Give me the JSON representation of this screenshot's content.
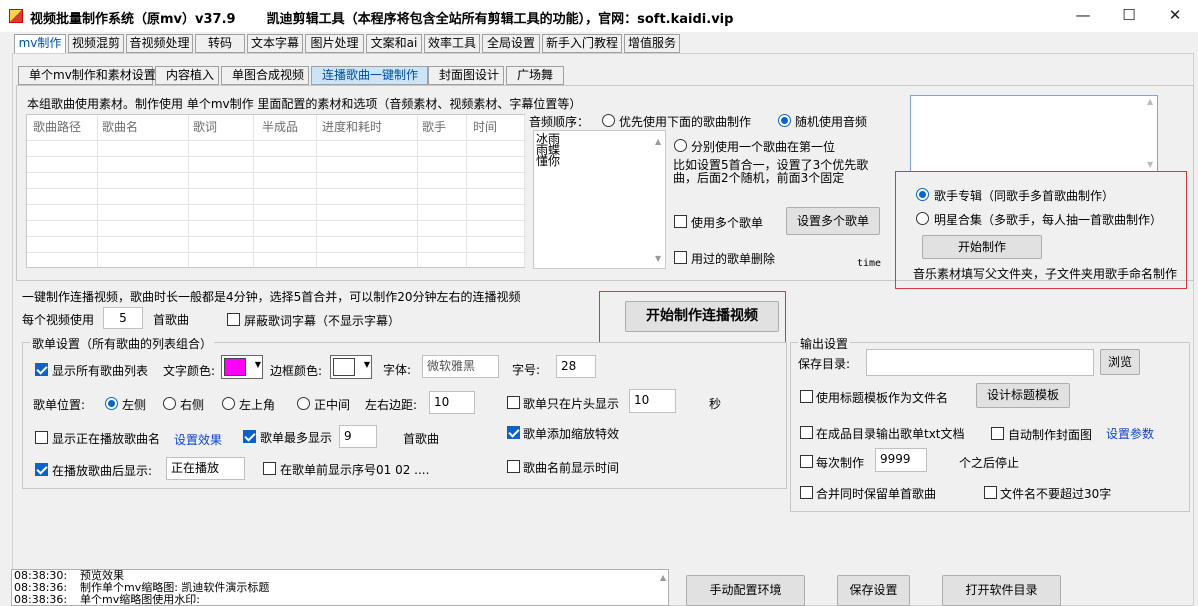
{
  "window": {
    "title": "视频批量制作系统（原mv）v37.9",
    "subtitle": "凯迪剪辑工具（本程序将包含全站所有剪辑工具的功能），官网：soft.kaidi.vip",
    "minimize": "—",
    "maximize": "☐",
    "close": "✕"
  },
  "main_tabs": [
    "mv制作",
    "视频混剪",
    "音视频处理",
    "转码",
    "文本字幕",
    "图片处理",
    "文案和ai",
    "效率工具",
    "全局设置",
    "新手入门教程",
    "增值服务"
  ],
  "sub_tabs": [
    "单个mv制作和素材设置",
    "内容植入",
    "单图合成视频",
    "连播歌曲一键制作",
    "封面图设计",
    "广场舞"
  ],
  "song_group": {
    "label": "本组歌曲使用素材。制作使用 单个mv制作 里面配置的素材和选项（音频素材、视频素材、字幕位置等）",
    "columns": [
      "歌曲路径",
      "歌曲名",
      "歌词",
      "半成品",
      "进度和耗时",
      "歌手",
      "时间"
    ]
  },
  "audio_order": {
    "label": "音频顺序：",
    "songs": [
      "冰雨",
      "雨蝶",
      "懂你"
    ],
    "opt_priority": "优先使用下面的歌曲制作",
    "opt_random": "随机使用音频",
    "opt_each_first": "分别使用一个歌曲在第一位",
    "note": "比如设置5首合一，设置了3个优先歌曲，后面2个随机，前面3个固定",
    "use_multi_list": "使用多个歌单",
    "set_multi_list": "设置多个歌单",
    "delete_used": "用过的歌单删除",
    "time_label": "time"
  },
  "artist_box": {
    "opt_album": "歌手专辑（同歌手多首歌曲制作）",
    "opt_collection": "明星合集（多歌手，每人抽一首歌曲制作）",
    "start": "开始制作",
    "note": "音乐素材填写父文件夹，子文件夹用歌手命名制作"
  },
  "one_click": {
    "label": "一键制作连播视频，歌曲时长一般都是4分钟，选择5首合并，可以制作20分钟左右的连播视频",
    "per_video": "每个视频使用",
    "count": "5",
    "unit": "首歌曲",
    "mask_lyrics": "屏蔽歌词字幕（不显示字幕）",
    "start_big": "开始制作连播视频"
  },
  "playlist": {
    "label": "歌单设置（所有歌曲的列表组合）",
    "show_all": "显示所有歌曲列表",
    "text_color_label": "文字颜色:",
    "text_color": "#ff00ff",
    "border_color_label": "边框颜色:",
    "border_color": "#ffffff",
    "font_label": "字体:",
    "font_value": "微软雅黑",
    "size_label": "字号:",
    "size_value": "28",
    "position_label": "歌单位置:",
    "pos_left": "左侧",
    "pos_right": "右侧",
    "pos_top_left": "左上角",
    "pos_center": "正中间",
    "margin_label": "左右边距:",
    "margin_value": "10",
    "only_head": "歌单只在片头显示",
    "head_value": "10",
    "sec": "秒",
    "show_playing": "显示正在播放歌曲名",
    "set_effect": "设置效果",
    "max_show": "歌单最多显示",
    "max_value": "9",
    "songs_unit": "首歌曲",
    "zoom_effect": "歌单添加缩放特效",
    "after_playing": "在播放歌曲后显示:",
    "playing_text": "正在播放",
    "show_number": "在歌单前显示序号01 02 ....",
    "show_time": "歌曲名前显示时间"
  },
  "output": {
    "label": "输出设置",
    "save_dir": "保存目录:",
    "browse": "浏览",
    "use_title_template": "使用标题模板作为文件名",
    "design_template": "设计标题模板",
    "export_txt": "在成品目录输出歌单txt文档",
    "auto_cover": "自动制作封面图",
    "set_params": "设置参数",
    "every_make": "每次制作",
    "every_value": "9999",
    "then_stop": "个之后停止",
    "keep_single": "合并同时保留单首歌曲",
    "name_limit": "文件名不要超过30字"
  },
  "log": {
    "lines": [
      {
        "time": "08:38:30:",
        "text": "预览效果"
      },
      {
        "time": "08:38:36:",
        "text": "制作单个mv缩略图: 凯迪软件演示标题"
      },
      {
        "time": "08:38:36:",
        "text": "单个mv缩略图使用水印:"
      }
    ]
  },
  "bottom_buttons": {
    "manual_env": "手动配置环境",
    "save_settings": "保存设置",
    "open_dir": "打开软件目录"
  }
}
